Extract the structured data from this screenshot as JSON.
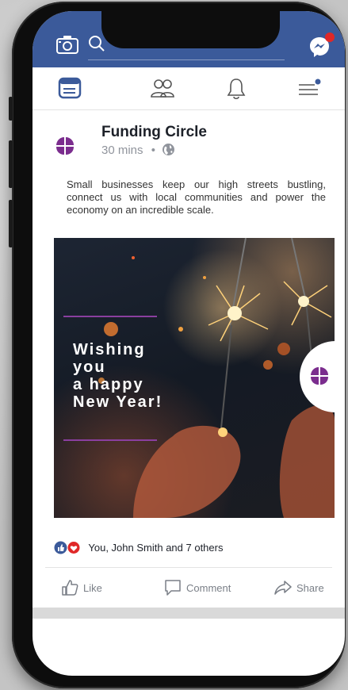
{
  "post": {
    "page_name": "Funding Circle",
    "time": "30 mins",
    "separator": "•",
    "text": "Small businesses keep our high streets bustling, connect us with local communities and power the economy on an incredible scale.",
    "image_text": "Wishing\nyou\na happy\nNew Year!"
  },
  "reactions": {
    "summary": "You, John Smith and 7 others"
  },
  "actions": {
    "like": "Like",
    "comment": "Comment",
    "share": "Share"
  },
  "colors": {
    "brand_blue": "#3b5a9a",
    "logo_purple": "#7b2d8e",
    "notification_red": "#e02828"
  },
  "icons": {
    "topbar": [
      "camera-icon",
      "search-icon",
      "messenger-icon"
    ],
    "nav": [
      "news-feed-icon",
      "friends-icon",
      "bell-icon",
      "menu-icon"
    ]
  }
}
